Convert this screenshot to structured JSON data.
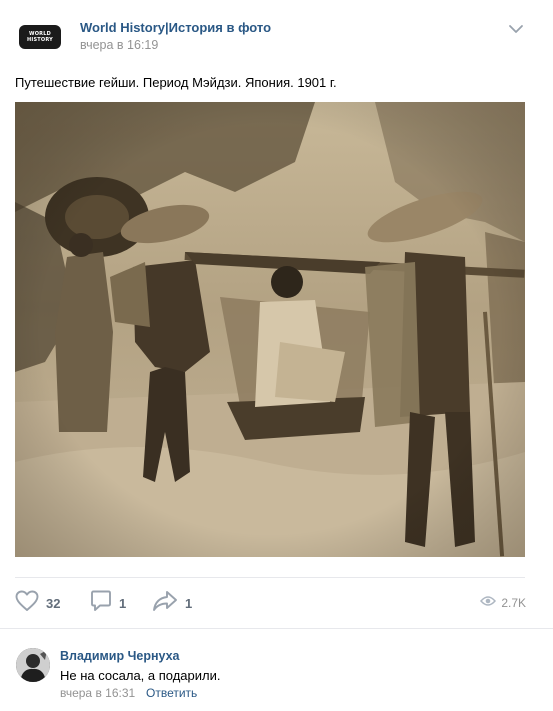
{
  "post": {
    "group_name": "World History|История в фото",
    "avatar_lines": [
      "WORLD",
      "HISTORY"
    ],
    "time": "вчера в 16:19",
    "text": "Путешествие гейши. Период Мэйдзи. Япония. 1901 г."
  },
  "actions": {
    "likes": "32",
    "comments": "1",
    "shares": "1",
    "views": "2.7K"
  },
  "icons": [
    "more-chevron-icon",
    "heart-icon",
    "comment-icon",
    "share-icon",
    "eye-icon"
  ],
  "colors": {
    "link": "#2a5885",
    "secondary_text": "#939393",
    "icon": "#99a2ad",
    "divider": "#e7e8ec",
    "photo_sepia": "#b5a48a"
  },
  "comment": {
    "author": "Владимир Чернуха",
    "text": "Не на сосала, а подарили.",
    "time": "вчера в 16:31",
    "reply_label": "Ответить"
  }
}
